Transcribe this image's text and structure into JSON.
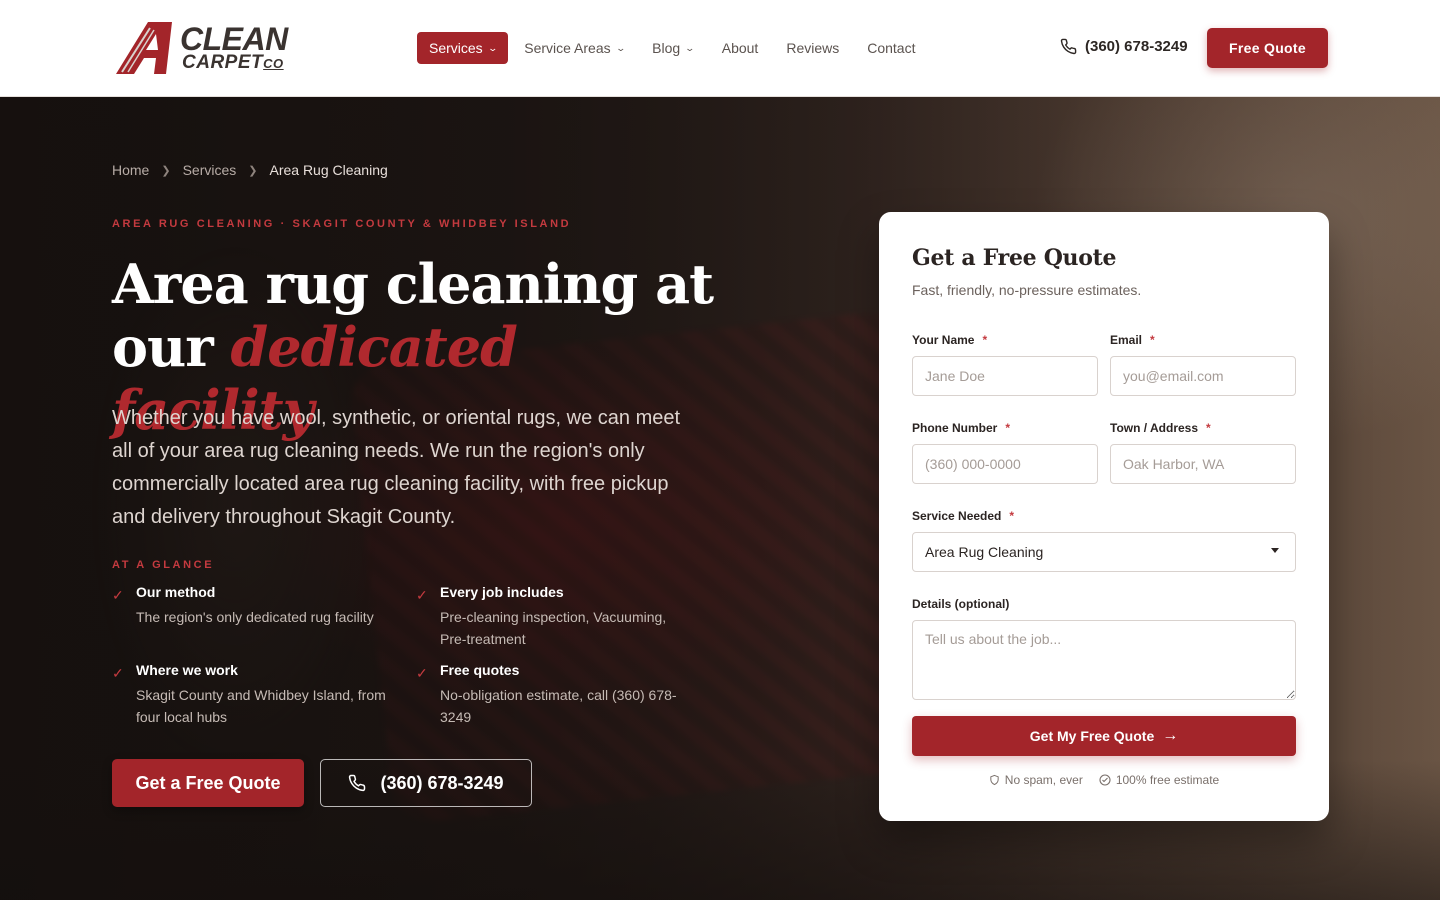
{
  "brand": {
    "logo_line1": "CLEAN",
    "logo_line2": "CARPET",
    "logo_co": "CO",
    "colors": {
      "accent": "#a3252a",
      "accent_text": "#c43a3f",
      "dark": "#2b2422"
    }
  },
  "nav": {
    "items": [
      {
        "label": "Services",
        "has_dropdown": true,
        "active": true
      },
      {
        "label": "Service Areas",
        "has_dropdown": true,
        "active": false
      },
      {
        "label": "Blog",
        "has_dropdown": true,
        "active": false
      },
      {
        "label": "About",
        "has_dropdown": false,
        "active": false
      },
      {
        "label": "Reviews",
        "has_dropdown": false,
        "active": false
      },
      {
        "label": "Contact",
        "has_dropdown": false,
        "active": false
      }
    ],
    "phone": "(360) 678-3249",
    "phone_icon": "phone-icon",
    "cta_label": "Free Quote"
  },
  "hero": {
    "breadcrumb": [
      "Home",
      "Services",
      "Area Rug Cleaning"
    ],
    "eyebrow": "AREA RUG CLEANING · SKAGIT COUNTY & WHIDBEY ISLAND",
    "title_line1": "Area rug cleaning at",
    "title_line2_plain": "our ",
    "title_line2_accent": "dedicated facility",
    "lead": "Whether you have wool, synthetic, or oriental rugs, we can meet all of your area rug cleaning needs. We run the region's only commercially located area rug cleaning facility, with free pickup and delivery throughout Skagit County.",
    "glance_label": "AT A GLANCE",
    "glance": [
      {
        "title": "Our method",
        "desc": "The region's only dedicated rug facility"
      },
      {
        "title": "Every job includes",
        "desc": "Pre-cleaning inspection, Vacuuming, Pre-treatment"
      },
      {
        "title": "Where we work",
        "desc": "Skagit County and Whidbey Island, from four local hubs"
      },
      {
        "title": "Free quotes",
        "desc": "No-obligation estimate, call (360) 678-3249"
      }
    ],
    "cta_primary": "Get a Free Quote",
    "cta_phone": "(360) 678-3249"
  },
  "form": {
    "title": "Get a Free Quote",
    "subtitle": "Fast, friendly, no-pressure estimates.",
    "name_label": "Your Name",
    "name_placeholder": "Jane Doe",
    "email_label": "Email",
    "email_placeholder": "you@email.com",
    "phone_label": "Phone Number",
    "phone_placeholder": "(360) 000-0000",
    "town_label": "Town / Address",
    "town_placeholder": "Oak Harbor, WA",
    "service_label": "Service Needed",
    "service_value": "Area Rug Cleaning",
    "details_label": "Details (optional)",
    "details_placeholder": "Tell us about the job...",
    "required_mark": "*",
    "submit_label": "Get My Free Quote",
    "trust_1": "No spam, ever",
    "trust_2": "100% free estimate"
  }
}
